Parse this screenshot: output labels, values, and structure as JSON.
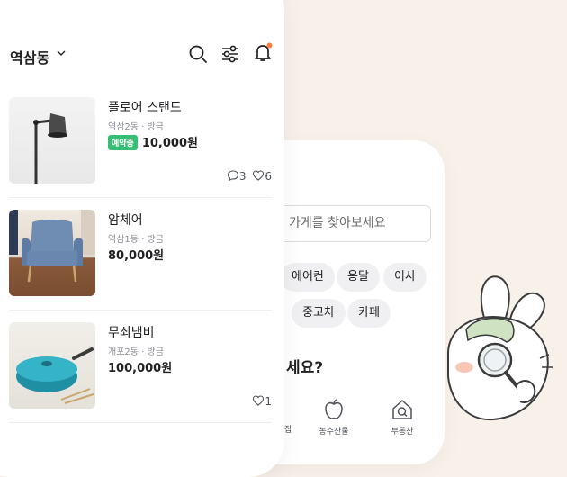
{
  "header": {
    "location": "역삼동",
    "icons": [
      "search-icon",
      "filter-icon",
      "bell-icon"
    ],
    "notification_dot_color": "#ff7e36"
  },
  "listings": [
    {
      "title": "플로어 스탠드",
      "meta": "역삼2동 · 방금",
      "badge": "예약중",
      "price": "10,000원",
      "comments": "3",
      "likes": "6"
    },
    {
      "title": "암체어",
      "meta": "역삼1동 · 방금",
      "price": "80,000원"
    },
    {
      "title": "무쇠냄비",
      "meta": "개포2동 · 방금",
      "price": "100,000원",
      "likes": "1"
    }
  ],
  "back_screen": {
    "search_placeholder": "가게를 찾아보세요",
    "chips": [
      "에어컨",
      "용달",
      "이사",
      "중고차",
      "카페"
    ],
    "heading_fragment": "세요?",
    "categories": [
      {
        "label": "집",
        "icon": "house-icon"
      },
      {
        "label": "농수산물",
        "icon": "apple-icon"
      },
      {
        "label": "부동산",
        "icon": "search-house-icon"
      }
    ]
  },
  "colors": {
    "accent": "#ff7e36",
    "reserved_badge": "#34bf74",
    "background": "#f7f1ea"
  }
}
